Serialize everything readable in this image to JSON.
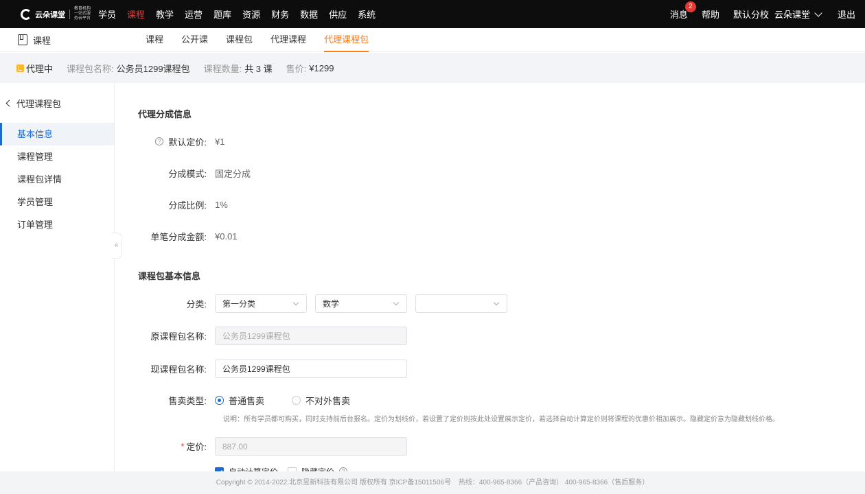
{
  "topbar": {
    "logo_text": "云朵课堂",
    "logo_slogan": "教育机构一站式服务云平台",
    "nav": [
      "学员",
      "课程",
      "教学",
      "运营",
      "题库",
      "资源",
      "财务",
      "数据",
      "供应",
      "系统"
    ],
    "active_nav": "课程",
    "messages_label": "消息",
    "messages_count": "2",
    "help_label": "帮助",
    "school_label": "默认分校",
    "account_label": "云朵课堂",
    "logout_label": "退出"
  },
  "subnav": {
    "title": "课程",
    "tabs": [
      "课程",
      "公开课",
      "课程包",
      "代理课程",
      "代理课程包"
    ],
    "active_tab": "代理课程包"
  },
  "strip": {
    "status": "代理中",
    "name_label": "课程包名称:",
    "name_value": "公务员1299课程包",
    "count_label": "课程数量:",
    "count_value": "共 3 课",
    "price_label": "售价:",
    "price_value": "¥1299"
  },
  "sidebar": {
    "back_label": "代理课程包",
    "items": [
      "基本信息",
      "课程管理",
      "课程包详情",
      "学员管理",
      "订单管理"
    ],
    "active_item": "基本信息",
    "collapse_glyph": "«"
  },
  "commission": {
    "title": "代理分成信息",
    "default_price_label": "默认定价:",
    "default_price_value": "¥1",
    "mode_label": "分成模式:",
    "mode_value": "固定分成",
    "ratio_label": "分成比例:",
    "ratio_value": "1%",
    "amount_label": "单笔分成金额:",
    "amount_value": "¥0.01"
  },
  "basic": {
    "title": "课程包基本信息",
    "category_label": "分类:",
    "category_1": "第一分类",
    "category_2": "数学",
    "category_3": "",
    "original_name_label": "原课程包名称:",
    "original_name_value": "公务员1299课程包",
    "current_name_label": "现课程包名称:",
    "current_name_value": "公务员1299课程包",
    "sale_type_label": "售卖类型:",
    "sale_type_options": [
      "普通售卖",
      "不对外售卖"
    ],
    "sale_type_selected": "普通售卖",
    "sale_note": "说明：所有学员都可购买，同时支持前后台报名。定价为划线价，若设置了定价则按此处设置展示定价，若选择自动计算定价则将课程的优惠价相加展示。隐藏定价意为隐藏划线价格。",
    "price_required_mark": "*",
    "price_label": "定价:",
    "price_value": "887.00",
    "auto_price_label": "自动计算定价",
    "auto_price_checked": true,
    "hide_price_label": "隐藏定价",
    "hide_price_checked": false
  },
  "footer": {
    "copyright": "Copyright © 2014-2022.北京昱新科技有限公司 版权所有 京ICP备15011506号",
    "hotline": "热线：400-965-8366（产品咨询） 400-965-8366（售后服务）"
  },
  "colors": {
    "nav_active": "#e53935",
    "subtab_active": "#ff7a1a",
    "primary": "#1a6bd6"
  }
}
